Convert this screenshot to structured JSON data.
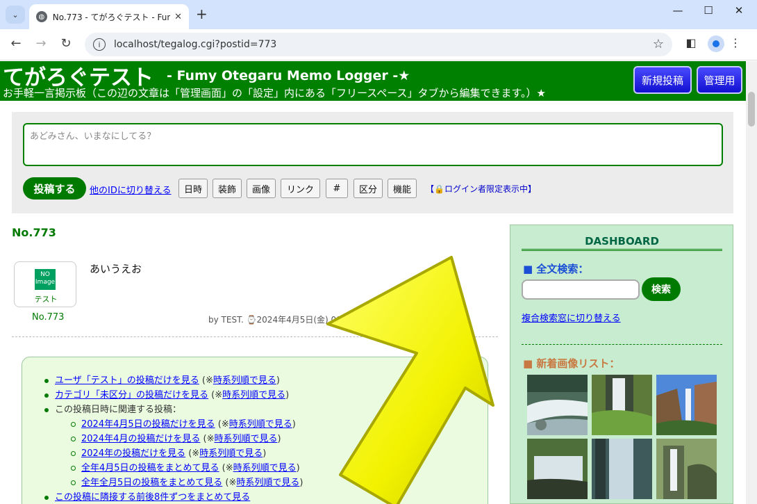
{
  "browser": {
    "tab_title": "No.773 - てがろぐテスト - Fumy Ot",
    "url": "localhost/tegalog.cgi?postid=773"
  },
  "header": {
    "title": "てがろぐテスト",
    "subtitle": "- Fumy Otegaru Memo Logger -★",
    "description": "お手軽一言掲示板（この辺の文章は「管理画面」の「設定」内にある「フリースペース」タブから編集できます。）★",
    "new_post": "新規投稿",
    "admin": "管理用"
  },
  "post_form": {
    "placeholder": "あどみさん、いまなにしてる？",
    "submit": "投稿する",
    "switch_id": "他のIDに切り替える",
    "tools": [
      "日時",
      "装飾",
      "画像",
      "リンク",
      "#",
      "区分",
      "機能"
    ],
    "login_only": "【🔒ログイン者限定表示中】"
  },
  "post": {
    "heading": "No.773",
    "avatar_badge": "NO Image",
    "avatar_name": "テスト",
    "number": "No.773",
    "text": "あいうえお",
    "meta": "by TEST.   ⌚2024年4月5日(金) 00:05:25〔7日前〕 〈5文字〉 編集"
  },
  "links": [
    {
      "link": "ユーザ「テスト」の投稿だけを見る",
      "sub": "時系列順で見る"
    },
    {
      "link": "カテゴリ「未区分」の投稿だけを見る",
      "sub": "時系列順で見る"
    },
    {
      "text": "この投稿日時に関連する投稿："
    },
    {
      "link": "2024年4月5日の投稿だけを見る",
      "sub": "時系列順で見る"
    },
    {
      "link": "2024年4月の投稿だけを見る",
      "sub": "時系列順で見る"
    },
    {
      "link": "2024年の投稿だけを見る",
      "sub": "時系列順で見る"
    },
    {
      "link": "全年4月5日の投稿をまとめて見る",
      "sub": "時系列順で見る"
    },
    {
      "link": "全年全月5日の投稿をまとめて見る",
      "sub": "時系列順で見る"
    },
    {
      "link": "この投稿に隣接する前後8件ずつをまとめて見る"
    }
  ],
  "sidebar": {
    "dashboard": "DASHBOARD",
    "search_heading": "■ 全文検索：",
    "search_button": "検索",
    "multi_search": "複合検索窓に切り替える",
    "images_heading": "■ 新着画像リスト："
  },
  "colors": {
    "header_green": "#008000",
    "button_blue": "#1010d0",
    "arrow_yellow": "#ffff33"
  }
}
